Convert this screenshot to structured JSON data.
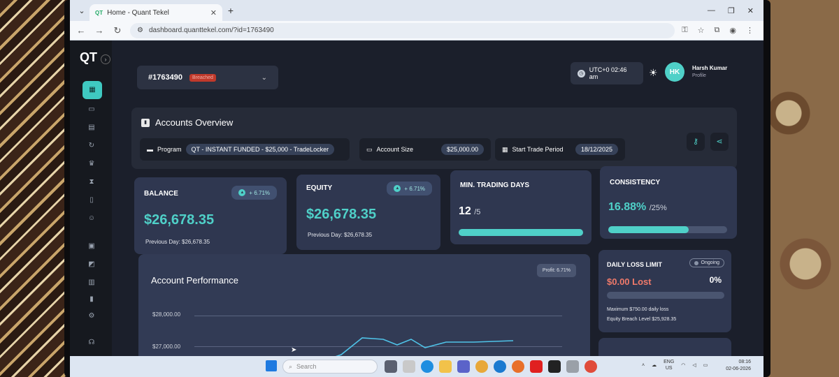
{
  "browser": {
    "tab_title": "Home - Quant Tekel",
    "tab_favicon": "QT",
    "url": "dashboard.quanttekel.com/?id=1763490"
  },
  "app": {
    "logo": "QT",
    "account": {
      "id": "#1763490",
      "badge": "Breached"
    },
    "time": "UTC+0 02:46 am",
    "user": {
      "initials": "HK",
      "name": "Harsh Kumar",
      "subtitle": "Profile"
    }
  },
  "overview": {
    "title": "Accounts Overview",
    "program_label": "Program",
    "program_value": "QT - INSTANT FUNDED - $25,000 - TradeLocker",
    "size_label": "Account Size",
    "size_value": "$25,000.00",
    "period_label": "Start Trade Period",
    "period_value": "18/12/2025"
  },
  "cards": {
    "balance": {
      "label": "BALANCE",
      "delta": "+ 6.71%",
      "value": "$26,678.35",
      "sub": "Previous Day: $26,678.35"
    },
    "equity": {
      "label": "EQUITY",
      "delta": "+ 6.71%",
      "value": "$26,678.35",
      "sub": "Previous Day: $26,678.35"
    },
    "trading_days": {
      "label": "MIN. TRADING DAYS",
      "value": "12",
      "of": "/5",
      "progress": 1.0
    },
    "consistency": {
      "label": "CONSISTENCY",
      "value": "16.88%",
      "of": "/25%",
      "progress": 0.6752
    }
  },
  "performance": {
    "title": "Account Performance",
    "badge": "Profit: 6.71%",
    "y_labels": [
      "$28,000.00",
      "$27,000.00"
    ]
  },
  "daily_loss": {
    "title": "DAILY LOSS LIMIT",
    "status": "Ongoing",
    "amount": "$0.00 Lost",
    "percent": "0%",
    "note1": "Maximum $750.00 daily loss",
    "note2": "Equity Breach Level $25,928.35"
  },
  "taskbar": {
    "search_placeholder": "Search",
    "lang1": "ENG",
    "lang2": "US",
    "time": "08:16",
    "date": "02-06-2026"
  },
  "colors": {
    "accent": "#4fd0c8",
    "loss": "#f07a6a",
    "breach": "#c0392b"
  }
}
